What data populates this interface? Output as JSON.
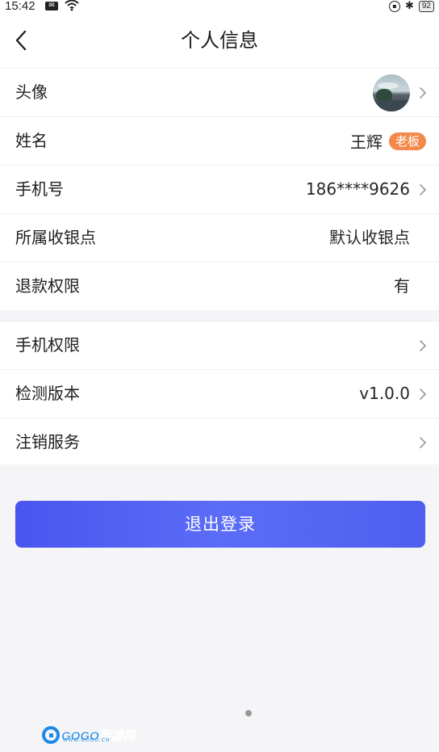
{
  "status_bar": {
    "time": "15:42",
    "battery": "92"
  },
  "header": {
    "title": "个人信息"
  },
  "profile": {
    "avatar_label": "头像",
    "name_label": "姓名",
    "name_value": "王辉",
    "role_badge": "老板",
    "phone_label": "手机号",
    "phone_value": "186****9626",
    "cashier_label": "所属收银点",
    "cashier_value": "默认收银点",
    "refund_label": "退款权限",
    "refund_value": "有"
  },
  "settings": {
    "phone_permission_label": "手机权限",
    "version_label": "检测版本",
    "version_value": "v1.0.0",
    "deregister_label": "注销服务"
  },
  "logout": {
    "label": "退出登录"
  },
  "watermark": {
    "text": "GOGO手游网",
    "sub": "WWW.GOGO.CN"
  },
  "colors": {
    "accent": "#5061f3",
    "badge": "#f2894a",
    "background": "#f5f5f7"
  }
}
